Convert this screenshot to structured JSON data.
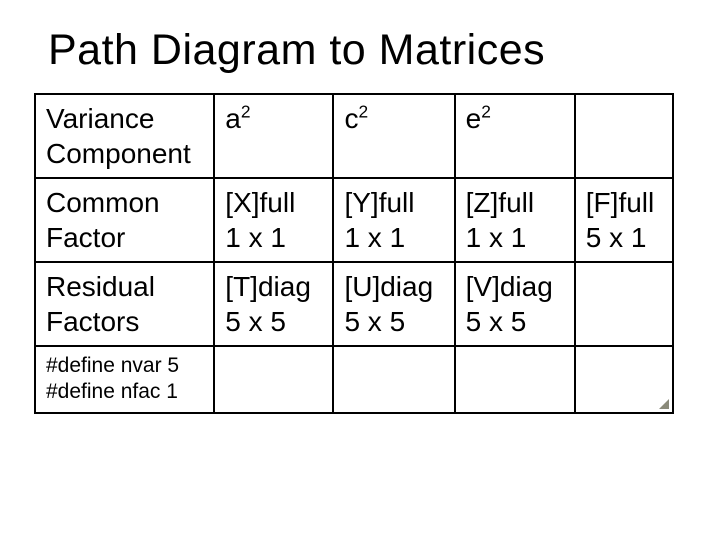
{
  "title": "Path Diagram to Matrices",
  "table": {
    "r0": {
      "c0": "Variance Component",
      "c1_base": "a",
      "c1_sup": "2",
      "c2_base": "c",
      "c2_sup": "2",
      "c3_base": "e",
      "c3_sup": "2",
      "c4": ""
    },
    "r1": {
      "c0": "Common Factor",
      "c1a": "[X]full",
      "c1b": "1 x 1",
      "c2a": "[Y]full",
      "c2b": "1 x 1",
      "c3a": "[Z]full",
      "c3b": "1 x 1",
      "c4a": "[F]full",
      "c4b": "5 x 1"
    },
    "r2": {
      "c0": "Residual Factors",
      "c1a": "[T]diag",
      "c1b": "5 x 5",
      "c2a": "[U]diag",
      "c2b": "5 x 5",
      "c3a": "[V]diag",
      "c3b": "5 x 5",
      "c4": ""
    },
    "r3": {
      "c0a": "#define nvar 5",
      "c0b": "#define nfac 1",
      "c1": "",
      "c2": "",
      "c3": "",
      "c4": ""
    }
  }
}
